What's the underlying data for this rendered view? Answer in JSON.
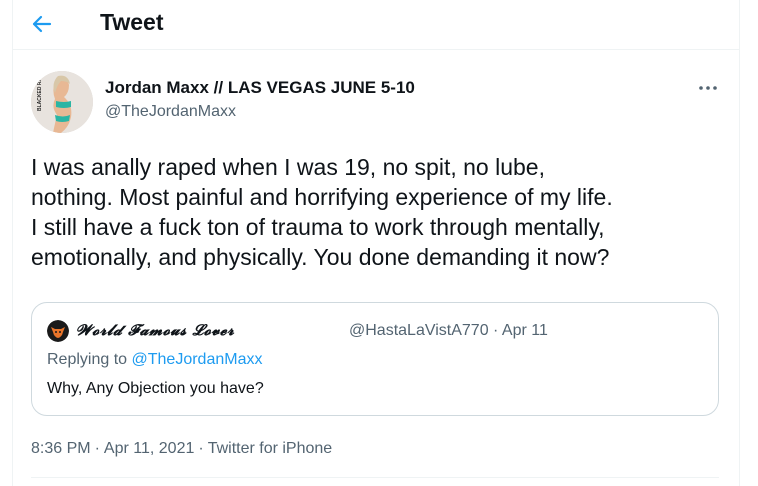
{
  "header": {
    "title": "Tweet",
    "back_icon": "arrow-left-icon"
  },
  "author": {
    "name": "Jordan Maxx // LAS VEGAS JUNE 5-10",
    "handle": "@TheJordanMaxx",
    "avatar_text": "BLACKED RAW"
  },
  "tweet": {
    "lines": [
      "I was anally raped when I was 19, no spit, no lube,",
      "nothing. Most painful and horrifying experience of my life.",
      "I still have a fuck ton of trauma to work through mentally,",
      "emotionally, and physically. You done demanding it now?"
    ]
  },
  "quote": {
    "name": "𝓦𝓸𝓻𝓵𝓭 𝓕𝓪𝓶𝓸𝓾𝓼 𝓛𝓸𝓿𝓮𝓻",
    "handle_date": "@HastaLaVistA770 · Apr 11",
    "replying_prefix": "Replying to ",
    "replying_handle": "@TheJordanMaxx",
    "text": "Why, Any Objection you have?"
  },
  "meta": {
    "time": "8:36 PM",
    "date": "Apr 11, 2021",
    "source": "Twitter for iPhone",
    "separator": "·"
  },
  "colors": {
    "accent": "#1d9bf0",
    "secondary_text": "#536471",
    "text": "#0f1419",
    "border": "#cfd9de"
  }
}
